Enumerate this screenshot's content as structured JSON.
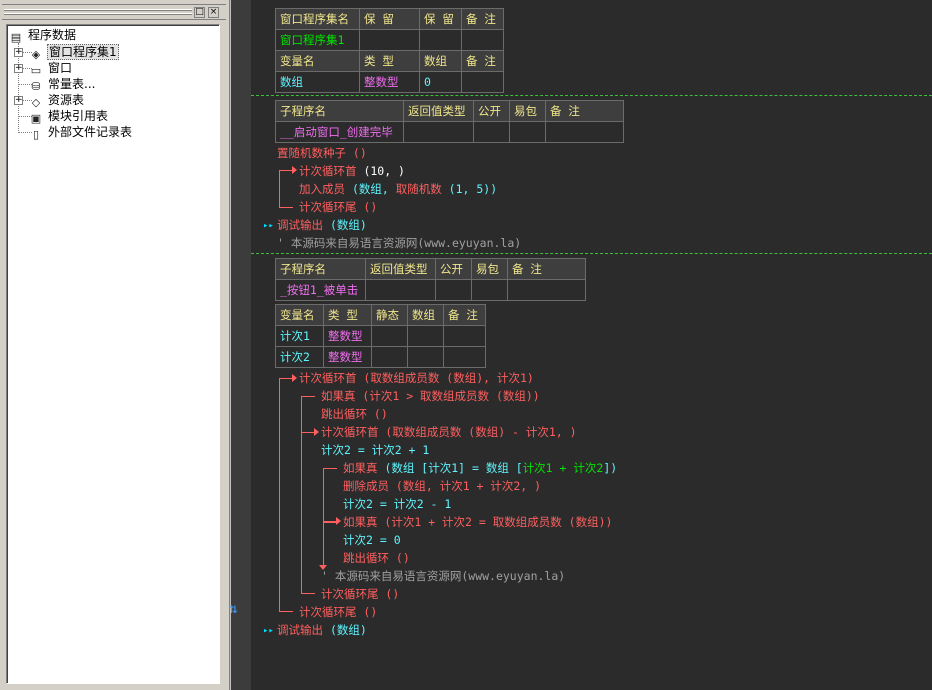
{
  "sidebar": {
    "panel_buttons": {
      "restore": "□",
      "close": "×"
    },
    "tree": {
      "root": "程序数据",
      "items": [
        {
          "label": "窗口程序集1",
          "icon": "layers-icon"
        },
        {
          "label": "窗口",
          "icon": "window-icon"
        },
        {
          "label": "常量表...",
          "icon": "constants-icon"
        },
        {
          "label": "资源表",
          "icon": "resources-icon"
        },
        {
          "label": "模块引用表",
          "icon": "module-icon"
        },
        {
          "label": "外部文件记录表",
          "icon": "file-icon"
        }
      ]
    }
  },
  "editor": {
    "assembly_table": {
      "headers": [
        "窗口程序集名",
        "保 留",
        "保 留",
        "备 注"
      ],
      "row": [
        "窗口程序集1",
        "",
        "",
        ""
      ],
      "var_headers": [
        "变量名",
        "类 型",
        "数组",
        "备 注"
      ],
      "var_row": [
        "数组",
        "整数型",
        "0",
        ""
      ]
    },
    "sub1": {
      "headers": [
        "子程序名",
        "返回值类型",
        "公开",
        "易包",
        "备 注"
      ],
      "name": "__启动窗口_创建完毕",
      "lines": {
        "l1": "置随机数种子 ()",
        "l2_kw": "计次循环首",
        "l2_args": "(10, )",
        "l3_kw": "加入成员",
        "l3_args": "(数组, ",
        "l3_fn": "取随机数",
        "l3_fargs": "(1, 5))",
        "l4": "计次循环尾 ()",
        "l5_kw": "调试输出",
        "l5_args": "(数组)",
        "l6": "' 本源码来自易语言资源网(www.eyuyan.la)"
      }
    },
    "sub2": {
      "headers": [
        "子程序名",
        "返回值类型",
        "公开",
        "易包",
        "备 注"
      ],
      "name": "_按钮1_被单击",
      "var_headers": [
        "变量名",
        "类 型",
        "静态",
        "数组",
        "备 注"
      ],
      "vars": [
        [
          "计次1",
          "整数型",
          "",
          "",
          ""
        ],
        [
          "计次2",
          "整数型",
          "",
          "",
          ""
        ]
      ],
      "lines": {
        "a": "计次循环首 (取数组成员数 (数组), 计次1)",
        "b": "如果真 (计次1 > 取数组成员数 (数组))",
        "c": "跳出循环 ()",
        "d": "计次循环首 (取数组成员数 (数组) - 计次1, )",
        "e": "计次2 = 计次2 + 1",
        "f_kw": "如果真",
        "f_args": "(数组 [计次1] = 数组 [",
        "f_idx": "计次1 + 计次2",
        "f_end": "])",
        "g": "删除成员 (数组, 计次1 + 计次2, )",
        "h": "计次2 = 计次2 - 1",
        "i": "如果真 (计次1 + 计次2 = 取数组成员数 (数组))",
        "j": "计次2 = 0",
        "k": "跳出循环 ()",
        "l": "' 本源码来自易语言资源网(www.eyuyan.la)",
        "m": "计次循环尾 ()",
        "n": "计次循环尾 ()",
        "o_kw": "调试输出",
        "o_args": "(数组)"
      }
    },
    "colors": {
      "background": "#2b2b2b",
      "keyword_red": "#ff5f5f",
      "identifier_cyan": "#5ff5ff",
      "type_pink": "#f06ef0",
      "header_yellow": "#f0e68c",
      "separator_green": "#3cbf3c",
      "comment_gray": "#a0a0a0"
    }
  }
}
